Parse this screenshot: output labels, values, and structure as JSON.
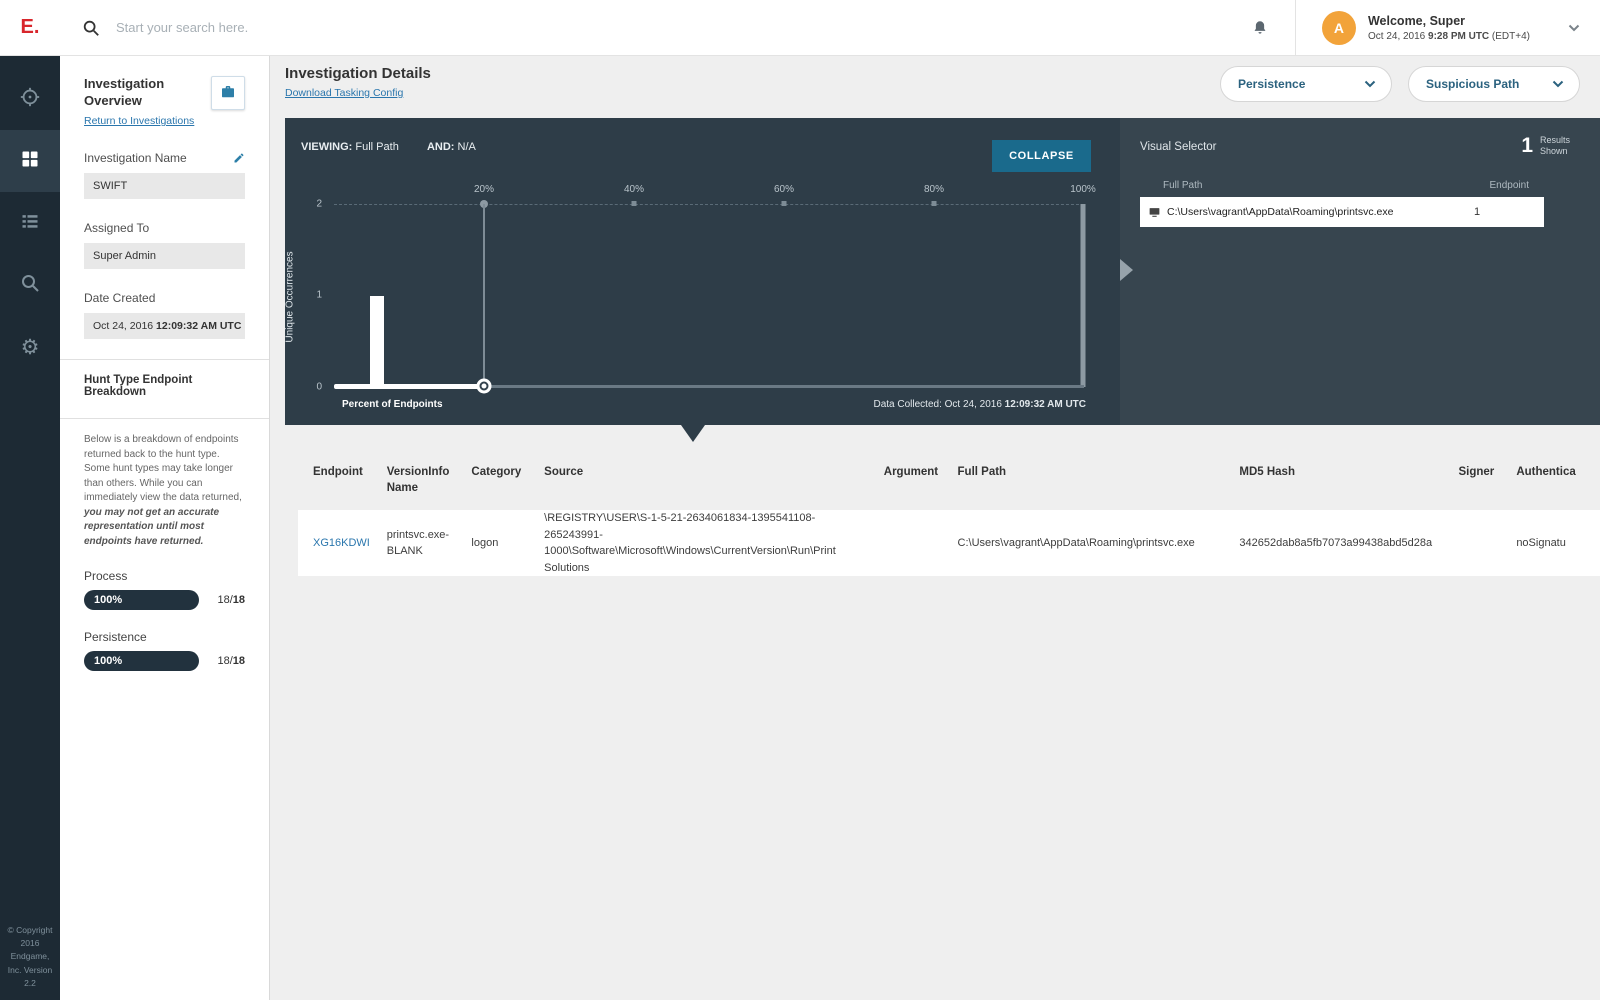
{
  "brand": {
    "logo_text": "E."
  },
  "nav": {
    "icons": [
      "hunt-icon",
      "investigations-grid-icon",
      "list-icon",
      "search-icon",
      "gear-icon"
    ],
    "copyright": "© Copyright 2016 Endgame, Inc. Version 2.2"
  },
  "topbar": {
    "search_placeholder": "Start your search here.",
    "user_name": "Welcome, Super",
    "date_prefix": "Oct 24, 2016 ",
    "time_bold": "9:28 PM UTC",
    "tz_suffix": " (EDT+4)",
    "avatar_initial": "A"
  },
  "sidebar": {
    "title": "Investigation Overview",
    "return_link": "Return to Investigations",
    "investigation_name_label": "Investigation Name",
    "investigation_name_value": "SWIFT",
    "assigned_to_label": "Assigned To",
    "assigned_to_value": "Super Admin",
    "date_created_label": "Date Created",
    "date_created_date": "Oct 24, 2016 ",
    "date_created_time": "12:09:32 AM UTC",
    "breakdown_title": "Hunt Type Endpoint Breakdown",
    "breakdown_text_normal": "Below is a breakdown of endpoints returned back to the hunt type. Some hunt types may take longer than others. While you can immediately view the data returned, ",
    "breakdown_text_em": "you may not get an accurate representation until most endpoints have returned.",
    "meters": [
      {
        "label": "Process",
        "percent": "100%",
        "count_prefix": "18/",
        "count_bold": "18"
      },
      {
        "label": "Persistence",
        "percent": "100%",
        "count_prefix": "18/",
        "count_bold": "18"
      }
    ]
  },
  "main": {
    "title": "Investigation Details",
    "download_link": "Download Tasking Config",
    "filters": [
      {
        "label": "Persistence"
      },
      {
        "label": "Suspicious Path"
      }
    ]
  },
  "chart": {
    "viewing_label": "VIEWING:",
    "viewing_value": "Full Path",
    "and_label": "AND:",
    "and_value": "N/A",
    "collapse_button": "COLLAPSE",
    "y_axis_label": "Unique Occurrences",
    "x_axis_label": "Percent of Endpoints",
    "x_ticks": [
      "20%",
      "40%",
      "60%",
      "80%",
      "100%"
    ],
    "y_ticks": [
      "2",
      "1",
      "0"
    ],
    "data_collected_prefix": "Data Collected: Oct 24, 2016 ",
    "data_collected_time": "12:09:32 AM UTC",
    "chart_data": {
      "type": "bar",
      "xlabel": "Percent of Endpoints",
      "ylabel": "Unique Occurrences",
      "x_axis_range_percent": [
        0,
        100
      ],
      "ylim": [
        0,
        2
      ],
      "bars": [
        {
          "x_percent": 6,
          "unique_occurrences": 1
        }
      ],
      "slider_selected_percent": 20,
      "gridline_dashed_at_y": 2
    }
  },
  "visual_selector": {
    "title": "Visual Selector",
    "results_count": "1",
    "results_label": "Results Shown",
    "col_full_path": "Full Path",
    "col_endpoint": "Endpoint",
    "rows": [
      {
        "full_path": "C:\\Users\\vagrant\\AppData\\Roaming\\printsvc.exe",
        "endpoint_count": "1"
      }
    ]
  },
  "results_table": {
    "columns": [
      "Endpoint",
      "VersionInfo Name",
      "Category",
      "Source",
      "Argument",
      "Full Path",
      "MD5 Hash",
      "Signer",
      "Authentica"
    ],
    "rows": [
      {
        "endpoint": "XG16KDWI",
        "versioninfo_name": "printsvc.exe-BLANK",
        "category": "logon",
        "source": "\\REGISTRY\\USER\\S-1-5-21-2634061834-1395541108-265243991-1000\\Software\\Microsoft\\Windows\\CurrentVersion\\Run\\Print Solutions",
        "argument": "",
        "full_path": "C:\\Users\\vagrant\\AppData\\Roaming\\printsvc.exe",
        "md5_hash": "342652dab8a5fb7073a99438abd5d28a",
        "signer": "",
        "authenticated": "noSignatu"
      }
    ]
  }
}
